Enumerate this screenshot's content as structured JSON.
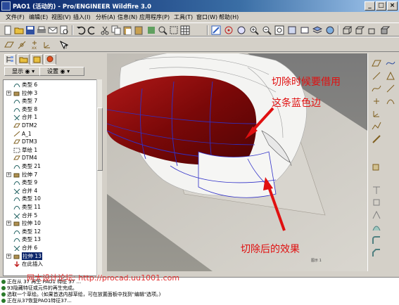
{
  "window": {
    "title": "PAO1 (活动的) - Pro/ENGINEER Wildfire 3.0",
    "min_label": "_",
    "max_label": "□",
    "close_label": "×"
  },
  "menu": [
    "文件(F)",
    "编辑(E)",
    "视图(V)",
    "插入(I)",
    "分析(A)",
    "信息(N)",
    "应用程序(P)",
    "工具(T)",
    "窗口(W)",
    "帮助(H)"
  ],
  "toolbar_icons": [
    "new-icon",
    "open-icon",
    "save-icon",
    "print-icon",
    "email-icon",
    "undo-icon",
    "redo-icon",
    "cut-icon",
    "copy-icon",
    "paste-icon",
    "regenerate-icon",
    "find-icon",
    "select-box-icon",
    "repaint-icon",
    "orient-icon",
    "zoom-in-icon",
    "zoom-out-icon",
    "refit-icon",
    "view-manager-icon",
    "layers-icon",
    "shaded-icon",
    "hidden-line-icon",
    "wireframe-icon",
    "datum-plane-icon",
    "datum-axis-icon",
    "datum-point-icon",
    "coord-sys-icon",
    "sketch-icon",
    "help-icon"
  ],
  "panel": {
    "show_label": "显示",
    "settings_label": "设置"
  },
  "tree": [
    {
      "label": "类型 6",
      "kind": "surface",
      "expand": ""
    },
    {
      "label": "拉伸 3",
      "kind": "extrude",
      "expand": "+"
    },
    {
      "label": "类型 7",
      "kind": "surface",
      "expand": ""
    },
    {
      "label": "类型 8",
      "kind": "surface",
      "expand": ""
    },
    {
      "label": "合并 1",
      "kind": "merge",
      "expand": ""
    },
    {
      "label": "DTM2",
      "kind": "plane",
      "expand": ""
    },
    {
      "label": "A_1",
      "kind": "axis",
      "expand": ""
    },
    {
      "label": "DTM3",
      "kind": "plane",
      "expand": ""
    },
    {
      "label": "草绘 1",
      "kind": "sketch",
      "expand": ""
    },
    {
      "label": "DTM4",
      "kind": "plane",
      "expand": ""
    },
    {
      "label": "类型 21",
      "kind": "surface",
      "expand": ""
    },
    {
      "label": "拉伸 7",
      "kind": "extrude",
      "expand": "+"
    },
    {
      "label": "类型 9",
      "kind": "surface",
      "expand": ""
    },
    {
      "label": "合并 4",
      "kind": "merge",
      "expand": ""
    },
    {
      "label": "类型 10",
      "kind": "surface",
      "expand": ""
    },
    {
      "label": "类型 11",
      "kind": "surface",
      "expand": ""
    },
    {
      "label": "合并 5",
      "kind": "merge",
      "expand": ""
    },
    {
      "label": "拉伸 10",
      "kind": "extrude",
      "expand": "+"
    },
    {
      "label": "类型 12",
      "kind": "surface",
      "expand": ""
    },
    {
      "label": "类型 13",
      "kind": "surface",
      "expand": ""
    },
    {
      "label": "合并 6",
      "kind": "merge",
      "expand": ""
    },
    {
      "label": "拉伸 13",
      "kind": "extrude",
      "expand": "+",
      "selected": true
    },
    {
      "label": "在此插入",
      "kind": "insert",
      "expand": ""
    }
  ],
  "annotations": {
    "top": "切除时候要借用",
    "middle": "这条蓝色边",
    "bottom": "切除后的效果"
  },
  "viewport_tag": "图示 1",
  "messages": [
    "正在从 37 再生 PAO1 特征 37 ...",
    "93隐藏特征或元件的再生完成。",
    "选取一个草绘。(如果首选内部草绘，可在放置面板中找到\"编辑\"选项。)",
    "正在从37恢复PAO1特征37..."
  ],
  "watermark": "网大设计论坛: http://procad.uu1001.com",
  "colors": {
    "body": "#8b0a0a",
    "edge": "#3030c8",
    "annotation": "#e01010"
  }
}
